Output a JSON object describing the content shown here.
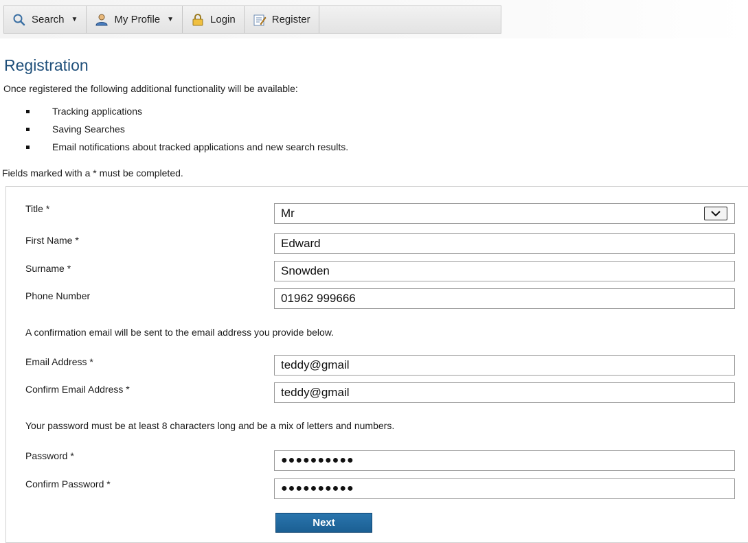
{
  "nav": {
    "items": [
      {
        "label": "Search",
        "icon": "search-icon",
        "has_dropdown": true
      },
      {
        "label": "My Profile",
        "icon": "user-icon",
        "has_dropdown": true
      },
      {
        "label": "Login",
        "icon": "padlock-icon",
        "has_dropdown": false
      },
      {
        "label": "Register",
        "icon": "register-icon",
        "has_dropdown": false
      }
    ]
  },
  "page": {
    "title": "Registration",
    "intro": "Once registered the following additional functionality will be available:",
    "features": [
      "Tracking applications",
      "Saving Searches",
      "Email notifications about tracked applications and new search results."
    ],
    "required_note": "Fields marked with a * must be completed."
  },
  "form": {
    "title_label": "Title *",
    "title_value": "Mr",
    "first_name_label": "First Name *",
    "first_name_value": "Edward",
    "surname_label": "Surname *",
    "surname_value": "Snowden",
    "phone_label": "Phone Number",
    "phone_value": "01962 999666",
    "email_info": "A confirmation email will be sent to the email address you provide below.",
    "email_label": "Email Address *",
    "email_value": "teddy@gmail",
    "confirm_email_label": "Confirm Email Address *",
    "confirm_email_value": "teddy@gmail",
    "password_info": "Your password must be at least 8 characters long and be a mix of letters and numbers.",
    "password_label": "Password *",
    "password_value": "●●●●●●●●●●",
    "confirm_password_label": "Confirm Password *",
    "confirm_password_value": "●●●●●●●●●●",
    "next_label": "Next"
  },
  "colors": {
    "heading": "#1f4f7a",
    "button": "#1b5f93"
  }
}
